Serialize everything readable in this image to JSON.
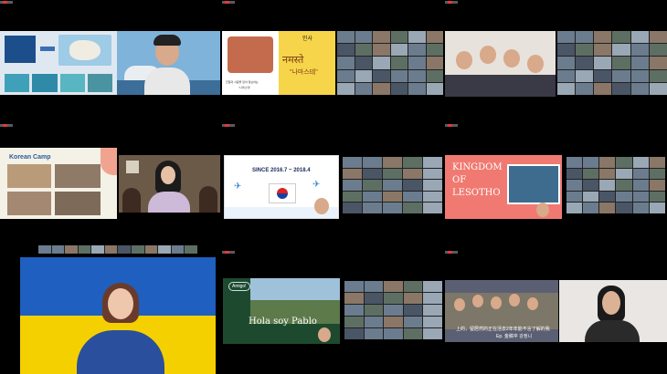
{
  "colors": {
    "background": "#000000",
    "record_dot": "#e03a3a",
    "ukraine_blue": "#1f5fbf",
    "ukraine_yellow": "#f5d000",
    "lesotho_coral": "#f07a72",
    "namaste_bg": "#f7d54a"
  },
  "tiles": {
    "australia": {
      "icon": "australia-map-icon"
    },
    "namaste": {
      "hello_label": "인사",
      "namaste_text": "नमस्ते",
      "namaste_korean": "\"나마스테\"",
      "caption_line1": "친절과 사람을 담아 정보하는",
      "caption_line2": "\"나마스테\""
    },
    "korean_camp": {
      "title": "Korean Camp"
    },
    "since": {
      "title": "SINCE 2016.7 ~ 2018.4",
      "flag_icon": "korea-flag-icon",
      "plane_icon": "airplane-icon"
    },
    "lesotho": {
      "title_line1": "KINGDOM",
      "title_line2": "OF",
      "title_line3": "LESOTHO"
    },
    "pablo": {
      "badge": "Amigo!",
      "greeting": "Hola soy Pablo"
    },
    "subtitle": {
      "line1": "上的，留居然的正在活去2年年能不言了解的我",
      "line2": "Ep. 金稿夲 강정니"
    }
  }
}
